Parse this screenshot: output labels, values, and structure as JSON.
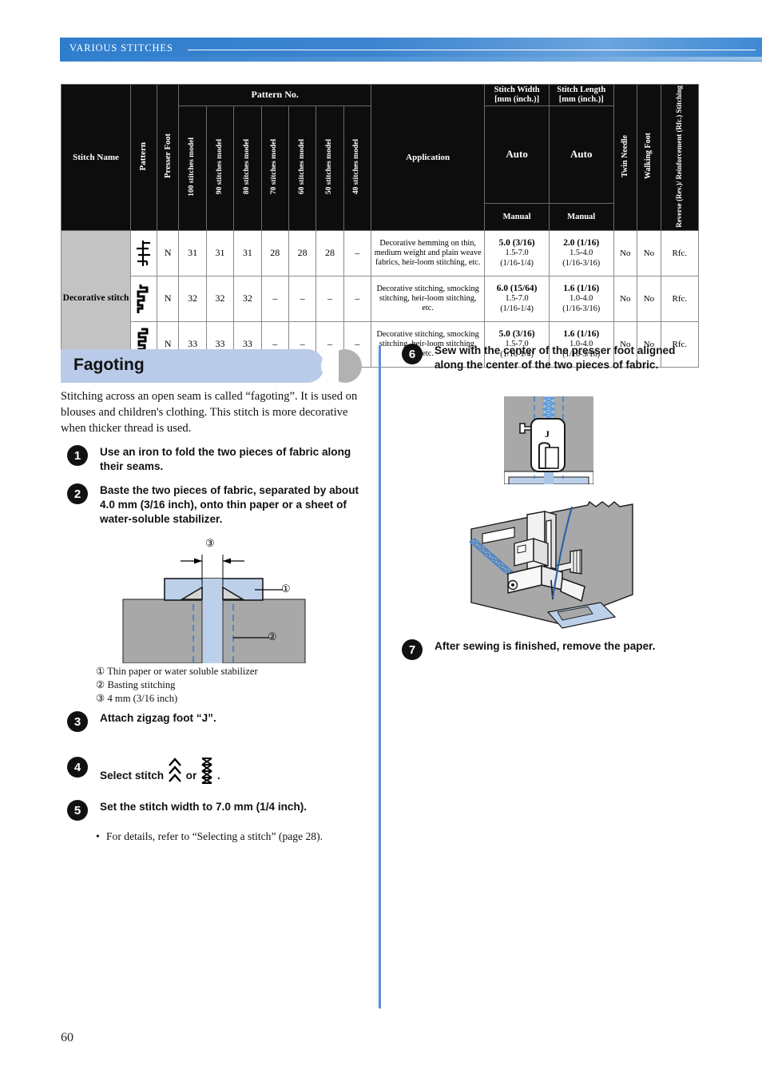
{
  "running_header": {
    "title": "VARIOUS STITCHES"
  },
  "page_number": "60",
  "table": {
    "headers": {
      "stitch_name": "Stitch Name",
      "pattern": "Pattern",
      "presser_foot": "Presser Foot",
      "pattern_no": "Pattern No.",
      "models": [
        "100 stitches model",
        "90 stitches model",
        "80 stitches model",
        "70 stitches model",
        "60 stitches model",
        "50 stitches model",
        "40 stitches model"
      ],
      "application": "Application",
      "stitch_width": "Stitch Width [mm (inch.)]",
      "stitch_length": "Stitch Length [mm (inch.)]",
      "auto": "Auto",
      "manual": "Manual",
      "twin_needle": "Twin Needle",
      "walking_foot": "Walking Foot",
      "reverse": "Reverse (Rev.)/ Reinforcement (Rfc.) Stitching"
    },
    "group_name": "Decorative stitch",
    "rows": [
      {
        "pattern_icon": "decorative-stitch-ladder-icon",
        "presser_foot": "N",
        "numbers": [
          "31",
          "31",
          "31",
          "28",
          "28",
          "28",
          "–"
        ],
        "application": "Decorative hemming on thin, medium weight and plain weave fabrics, heir-loom stitching, etc.",
        "width_auto": "5.0 (3/16)",
        "width_range_mm": "1.5-7.0",
        "width_range_in": "(1/16-1/4)",
        "length_auto": "2.0 (1/16)",
        "length_range_mm": "1.5-4.0",
        "length_range_in": "(1/16-3/16)",
        "twin_needle": "No",
        "walking_foot": "No",
        "reverse": "Rfc."
      },
      {
        "pattern_icon": "decorative-stitch-step-icon",
        "presser_foot": "N",
        "numbers": [
          "32",
          "32",
          "32",
          "–",
          "–",
          "–",
          "–"
        ],
        "application": "Decorative stitching, smocking stitching, heir-loom stitching, etc.",
        "width_auto": "6.0 (15/64)",
        "width_range_mm": "1.5-7.0",
        "width_range_in": "(1/16-1/4)",
        "length_auto": "1.6 (1/16)",
        "length_range_mm": "1.0-4.0",
        "length_range_in": "(1/16-3/16)",
        "twin_needle": "No",
        "walking_foot": "No",
        "reverse": "Rfc."
      },
      {
        "pattern_icon": "decorative-stitch-zigzag-step-icon",
        "presser_foot": "N",
        "numbers": [
          "33",
          "33",
          "33",
          "–",
          "–",
          "–",
          "–"
        ],
        "application": "Decorative stitching, smocking stitching, heir-loom stitching, etc.",
        "width_auto": "5.0 (3/16)",
        "width_range_mm": "1.5-7.0",
        "width_range_in": "(1/16-1/4)",
        "length_auto": "1.6 (1/16)",
        "length_range_mm": "1.0-4.0",
        "length_range_in": "(1/16-3/16)",
        "twin_needle": "No",
        "walking_foot": "No",
        "reverse": "Rfc."
      }
    ]
  },
  "section": {
    "title": "Fagoting",
    "intro": "Stitching across an open seam is called “fagoting”. It is used on blouses and children's clothing. This stitch is more decorative when thicker thread is used."
  },
  "steps": {
    "s1": {
      "num": "1",
      "text": "Use an iron to fold the two pieces of fabric along their seams."
    },
    "s2": {
      "num": "2",
      "text": "Baste the two pieces of fabric, separated by about 4.0 mm (3/16 inch), onto thin paper or a sheet of water-soluble stabilizer."
    },
    "s3": {
      "num": "3",
      "text": "Attach zigzag foot “J”."
    },
    "s4": {
      "num": "4",
      "text_before": "Select stitch",
      "text_mid": "or",
      "text_after": "."
    },
    "s5": {
      "num": "5",
      "text": "Set the stitch width to 7.0 mm (1/4 inch)."
    },
    "s5_note": {
      "bullet": "•",
      "text": "For details, refer to “Selecting a stitch” (page 28)."
    },
    "s6": {
      "num": "6",
      "text": "Sew with the center of the presser foot aligned along the center of the two pieces of fabric."
    },
    "s7": {
      "num": "7",
      "text": "After sewing is finished, remove the paper."
    }
  },
  "figure_legend": {
    "item1": {
      "marker": "①",
      "text": "Thin paper or water soluble stabilizer"
    },
    "item2": {
      "marker": "②",
      "text": "Basting stitching"
    },
    "item3": {
      "marker": "③",
      "text": "4 mm (3/16 inch)"
    }
  },
  "figure_markers": {
    "m1": "①",
    "m2": "②",
    "m3": "③",
    "presser_foot_label": "J"
  },
  "colors": {
    "header_blue": "#2f7ecd",
    "pill_blue": "#b9cbe8",
    "divider_blue": "#5b8fd4",
    "fabric_gray": "#a8a8a8",
    "stabilizer_blue": "#bcd0ea",
    "thread_blue": "#3f7fc8"
  }
}
